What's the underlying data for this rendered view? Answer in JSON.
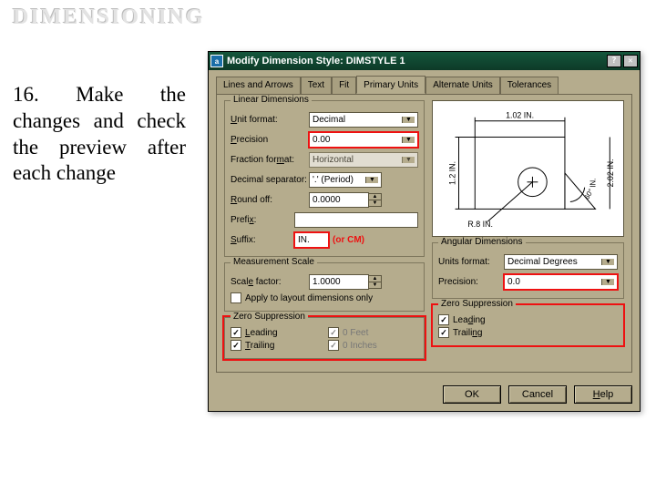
{
  "page": {
    "heading": "DIMENSIONING",
    "instruction": "16. Make the changes and check the preview after each change"
  },
  "window": {
    "title": "Modify Dimension Style: DIMSTYLE 1"
  },
  "tabs": {
    "t0": "Lines and Arrows",
    "t1": "Text",
    "t2": "Fit",
    "t3": "Primary Units",
    "t4": "Alternate Units",
    "t5": "Tolerances"
  },
  "linear": {
    "title": "Linear Dimensions",
    "unit_format_label": "Unit format:",
    "unit_format": "Decimal",
    "precision_label": "Precision",
    "precision": "0.00",
    "fraction_format_label": "Fraction format:",
    "fraction_format": "Horizontal",
    "decimal_sep_label": "Decimal separator:",
    "decimal_sep": "'.' (Period)",
    "round_off_label": "Round off:",
    "round_off": "0.0000",
    "prefix_label": "Prefix:",
    "prefix": "",
    "suffix_label": "Suffix:",
    "suffix": "IN.",
    "suffix_note": "(or CM)"
  },
  "scale": {
    "title": "Measurement Scale",
    "scale_factor_label": "Scale factor:",
    "scale_factor": "1.0000",
    "apply_layout": "Apply to layout dimensions only"
  },
  "zero_left": {
    "title": "Zero Suppression",
    "leading": "Leading",
    "trailing": "Trailing",
    "feet": "0 Feet",
    "inches": "0 Inches"
  },
  "angular": {
    "title": "Angular Dimensions",
    "units_format_label": "Units format:",
    "units_format": "Decimal Degrees",
    "precision_label": "Precision:",
    "precision": "0.0"
  },
  "zero_right": {
    "title": "Zero Suppression",
    "leading": "Leading",
    "trailing": "Trailing"
  },
  "preview_labels": {
    "top": "1.02 IN.",
    "left": "1.2 IN.",
    "rightA": "2.02 IN.",
    "rightB": "IN.",
    "angle": "60°",
    "radius": "R.8 IN."
  },
  "buttons": {
    "ok": "OK",
    "cancel": "Cancel",
    "help": "Help"
  }
}
